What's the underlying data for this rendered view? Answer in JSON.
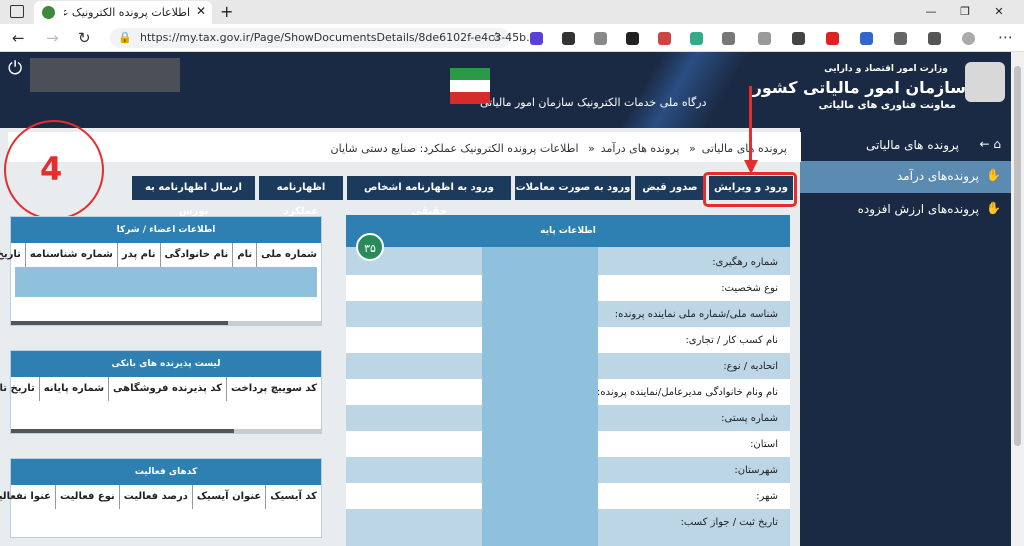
{
  "browser": {
    "tab_title": "اطلاعات پرونده الکترونیک عملکرد: ...",
    "url": "https://my.tax.gov.ir/Page/ShowDocumentsDetails/8de6102f-e4c3-45b..."
  },
  "header": {
    "org_line1": "وزارت امور اقتصاد و دارایی",
    "org_title": "سازمان امور مالیاتی کشور",
    "org_line3": "معاونت فناوری های مالیاتی",
    "portal": "درگاه ملی خدمات الکترونیک سازمان امور مالیاتی"
  },
  "sidebar": {
    "items": [
      {
        "label": "پرونده های مالیاتی"
      },
      {
        "label": "پرونده‌های درآمد"
      },
      {
        "label": "پرونده‌های ارزش افزوده"
      }
    ]
  },
  "breadcrumb": {
    "items": [
      "پرونده های مالیاتی",
      "پرونده های درآمد",
      "اطلاعات پرونده الکترونیک عملکرد: صنایع دستی شایان"
    ]
  },
  "annotation": {
    "step": "4"
  },
  "actions": [
    "ورود و ویرایش",
    "صدور قبض",
    "ورود به صورت معاملات",
    "ورود به اظهارنامه اشخاص حقیقی",
    "اظهارنامه عملکرد",
    "ارسال اظهارنامه به بورس"
  ],
  "base_info": {
    "title": "اطلاعات پایه",
    "badge": "۳۵",
    "rows": [
      "شماره رهگیری:",
      "نوع شخصیت:",
      "شناسه ملی/شماره ملی نماینده پرونده:",
      "نام کسب کار / تجاری:",
      "اتحادیه / نوع:",
      "نام ونام خانوادگی مدیرعامل/نماینده پرونده:",
      "شماره پستی:",
      "استان:",
      "شهرستان:",
      "شهر:",
      "تاریخ ثبت / جواز کسب:"
    ]
  },
  "members": {
    "title": "اطلاعات اعضاء / شرکا",
    "columns": [
      "شماره ملی",
      "نام",
      "نام خانوادگی",
      "نام پدر",
      "شماره شناسنامه",
      "تاریخ"
    ]
  },
  "banks": {
    "title": "لیست پذیرنده های بانکی",
    "columns": [
      "کد سوییچ پرداخت",
      "کد پذیرنده فروشگاهی",
      "شماره پایانه",
      "تاریخ تایید"
    ]
  },
  "activities": {
    "title": "کدهای فعالیت",
    "columns": [
      "کد آیسیک",
      "عنوان آیسیک",
      "درصد فعالیت",
      "نوع فعالیت",
      "عنوا نفعالیت"
    ]
  }
}
